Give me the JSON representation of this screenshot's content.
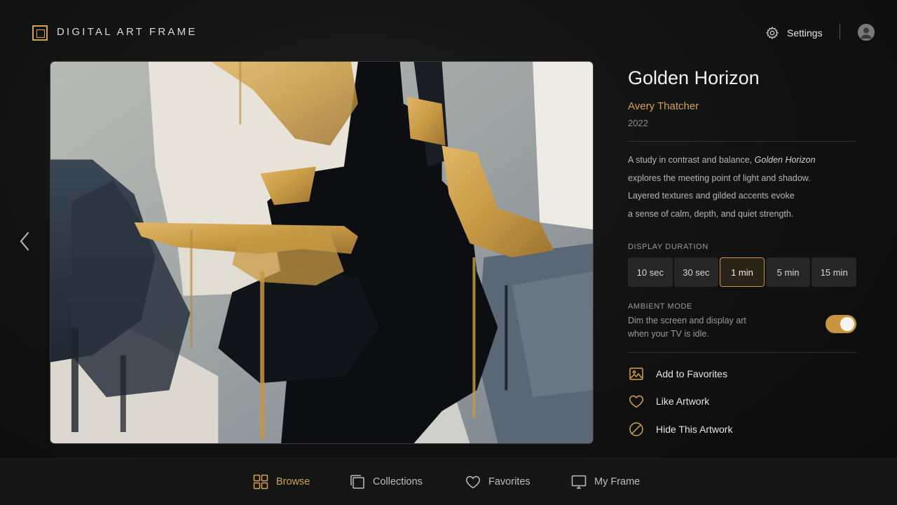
{
  "app": {
    "brand": "DIGITAL ART FRAME",
    "settings_label": "Settings",
    "accent_color": "#d4a24c"
  },
  "artwork": {
    "title": "Golden Horizon",
    "artist": "Avery Thatcher",
    "year": "2022",
    "description": {
      "line1_prefix": "A study in contrast and balance, ",
      "line1_emphasis": "Golden Horizon",
      "line2": "explores the meeting point of light and shadow.",
      "line3": "Layered textures and gilded accents evoke",
      "line4": "a sense of calm, depth, and quiet strength."
    },
    "palette": [
      "#d4a24c",
      "#0c0e12",
      "#e7e2d8",
      "#4f5d6b",
      "#9ea3a3"
    ]
  },
  "display_duration": {
    "label": "DISPLAY DURATION",
    "options": [
      "10 sec",
      "30 sec",
      "1 min",
      "5 min",
      "15 min"
    ],
    "selected": "1 min"
  },
  "ambient_mode": {
    "label": "AMBIENT MODE",
    "description_line1": "Dim the screen and display art",
    "description_line2": "when your TV is idle.",
    "enabled": true
  },
  "actions": [
    {
      "label": "Add to Favorites",
      "icon": "image-icon"
    },
    {
      "label": "Like Artwork",
      "icon": "heart-icon"
    },
    {
      "label": "Hide This Artwork",
      "icon": "hide-icon"
    }
  ],
  "bottom_nav": [
    {
      "label": "Browse",
      "icon": "grid-icon",
      "active": true
    },
    {
      "label": "Collections",
      "icon": "collections-icon",
      "active": false
    },
    {
      "label": "Favorites",
      "icon": "heart-icon",
      "active": false
    },
    {
      "label": "My Frame",
      "icon": "monitor-icon",
      "active": false
    }
  ]
}
